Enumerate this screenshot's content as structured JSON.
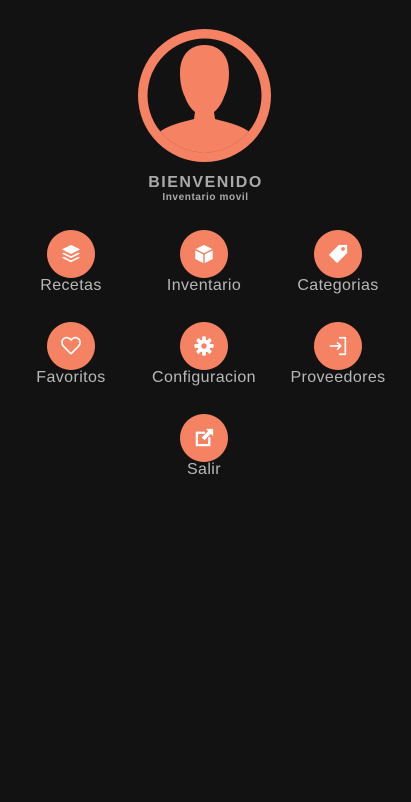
{
  "header": {
    "title": "BIENVENIDO",
    "subtitle": "Inventario movil"
  },
  "menu": {
    "recetas": "Recetas",
    "inventario": "Inventario",
    "categorias": "Categorias",
    "favoritos": "Favoritos",
    "configuracion": "Configuracion",
    "proveedores": "Proveedores",
    "salir": "Salir"
  },
  "icons": {
    "recetas": "layers-icon",
    "inventario": "box-icon",
    "categorias": "tag-icon",
    "favoritos": "heart-icon",
    "configuracion": "gear-icon",
    "proveedores": "sign-in-icon",
    "salir": "external-link-icon"
  },
  "colors": {
    "accent": "#f58262",
    "background": "#121212",
    "text": "#b8b8b8"
  }
}
